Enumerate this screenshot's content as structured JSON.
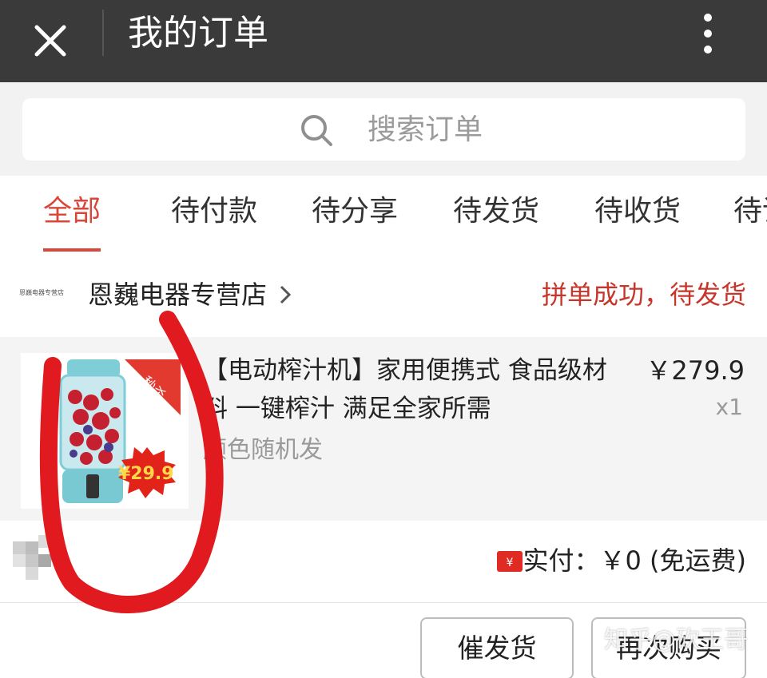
{
  "header": {
    "title": "我的订单",
    "close_icon": "close-icon",
    "more_icon": "more-vertical-icon"
  },
  "search": {
    "placeholder": "搜索订单",
    "icon": "search-icon"
  },
  "tabs": [
    {
      "label": "全部",
      "active": true
    },
    {
      "label": "待付款"
    },
    {
      "label": "待分享"
    },
    {
      "label": "待发货"
    },
    {
      "label": "待收货"
    },
    {
      "label": "待评"
    }
  ],
  "order": {
    "shop_logo_text": "恩巍电器专营店",
    "shop_name": "恩巍电器专营店",
    "status": "拼单成功，待发货",
    "product": {
      "title": "【电动榨汁机】家用便携式 食品级材料 一键榨汁 满足全家所需",
      "spec": "颜色随机发",
      "price": "￥279.9",
      "quantity": "x1",
      "badge_text": "秒杀",
      "sticker_price": "¥29.9"
    },
    "payment": {
      "label": "实付：",
      "amount": "￥0",
      "note": "(免运费)"
    }
  },
  "actions": {
    "urge_label": "催发货",
    "rebuy_label": "再次购买"
  },
  "watermark": "知乎@砍王哥",
  "colors": {
    "titlebar": "#3a3a3a",
    "accent": "#d9473a",
    "status": "#c7362b",
    "annotation": "#e01a1f"
  }
}
